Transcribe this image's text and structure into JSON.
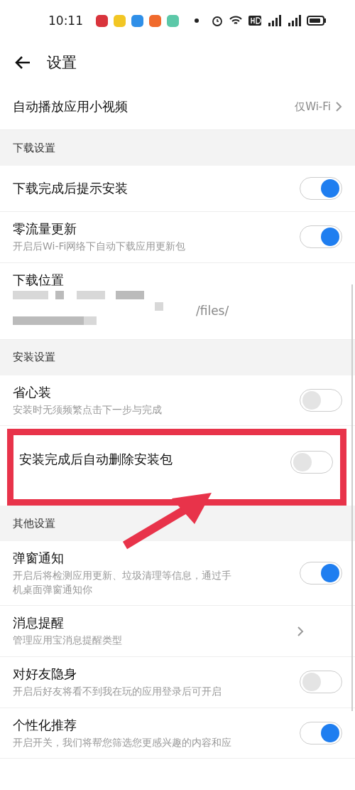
{
  "status_bar": {
    "time": "10:11",
    "app_icons": [
      {
        "color": "#d9343c"
      },
      {
        "color": "#f2c624"
      },
      {
        "color": "#2f8fe8"
      },
      {
        "color": "#f06a2c"
      },
      {
        "color": "#5cc8a8"
      }
    ]
  },
  "header": {
    "title": "设置"
  },
  "sections": [
    {
      "items": [
        {
          "kind": "link",
          "title": "自动播放应用小视频",
          "value": "仅Wi-Fi"
        }
      ]
    },
    {
      "label": "下载设置",
      "items": [
        {
          "kind": "toggle",
          "title": "下载完成后提示安装",
          "on": true
        },
        {
          "kind": "toggle",
          "title": "零流量更新",
          "description": "开启后Wi-Fi网络下自动下载应用更新包",
          "on": true
        },
        {
          "kind": "path",
          "title": "下载位置",
          "path": "/files/"
        }
      ]
    },
    {
      "label": "安装设置",
      "items": [
        {
          "kind": "toggle",
          "title": "省心装",
          "description": "安装时无须频繁点击下一步与完成",
          "on": false
        },
        {
          "kind": "toggle",
          "title": "安装完成后自动删除安装包",
          "on": false,
          "highlighted": true
        }
      ]
    },
    {
      "label": "其他设置",
      "items": [
        {
          "kind": "toggle",
          "title": "弹窗通知",
          "description": "开启后将检测应用更新、垃圾清理等信息，通过手机桌面弹窗通知你",
          "on": true
        },
        {
          "kind": "link",
          "title": "消息提醒",
          "description": "管理应用宝消息提醒类型"
        },
        {
          "kind": "toggle",
          "title": "对好友隐身",
          "description": "开启后好友将看不到我在玩的应用登录后可开启",
          "on": false
        },
        {
          "kind": "toggle",
          "title": "个性化推荐",
          "description": "开启开关，我们将帮您筛选您更感兴趣的内容和应",
          "on": true
        }
      ]
    }
  ]
}
